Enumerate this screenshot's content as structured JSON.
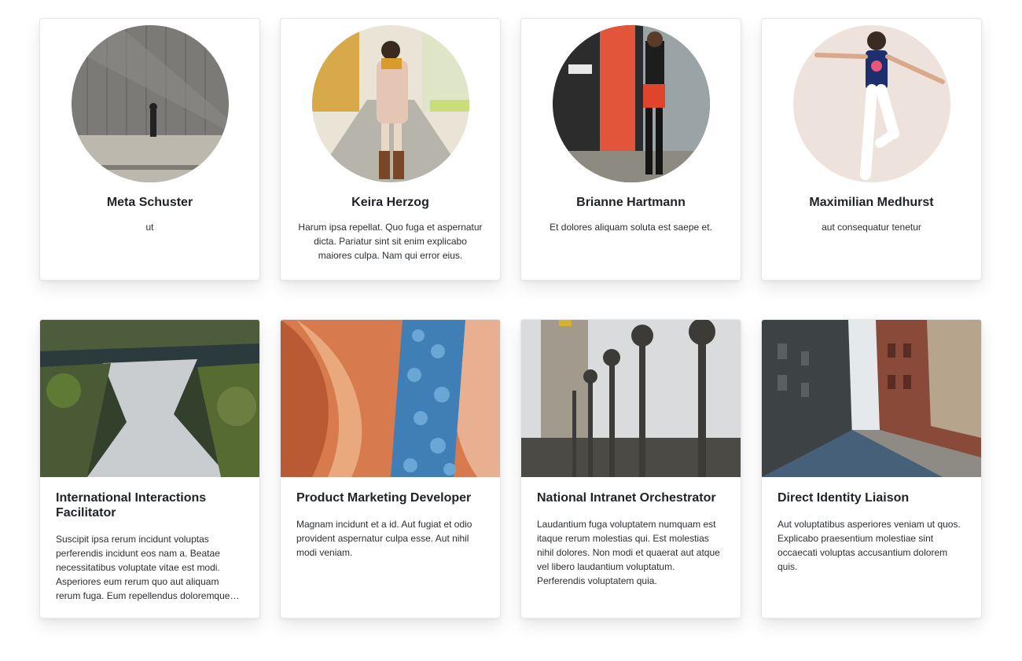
{
  "people": [
    {
      "name": "Meta Schuster",
      "text": "ut",
      "image_icon": "person-walking-by-wall-photo"
    },
    {
      "name": "Keira Herzog",
      "text": "Harum ipsa repellat. Quo fuga et aspernatur dicta. Pariatur sint sit enim explicabo maiores culpa. Nam qui error eius.",
      "image_icon": "woman-in-coat-photo"
    },
    {
      "name": "Brianne Hartmann",
      "text": "Et dolores aliquam soluta est saepe et.",
      "image_icon": "woman-with-phone-photo"
    },
    {
      "name": "Maximilian Medhurst",
      "text": "aut consequatur tenetur",
      "image_icon": "woman-jumping-photo"
    }
  ],
  "posts": [
    {
      "title": "International Interactions Facilitator",
      "text": "Suscipit ipsa rerum incidunt voluptas perferendis incidunt eos nam a. Beatae necessitatibus voluptate vitae est modi. Asperiores eum rerum quo aut aliquam rerum fuga. Eum repellendus doloremque quia.",
      "image_icon": "waterfall-photo"
    },
    {
      "title": "Product Marketing Developer",
      "text": "Magnam incidunt et a id. Aut fugiat et odio provident aspernatur culpa esse. Aut nihil modi veniam.",
      "image_icon": "canyon-stones-photo"
    },
    {
      "title": "National Intranet Orchestrator",
      "text": "Laudantium fuga voluptatem numquam est itaque rerum molestias qui. Est molestias nihil dolores. Non modi et quaerat aut atque vel libero laudantium voluptatum. Perferendis voluptatem quia.",
      "image_icon": "street-lamps-photo"
    },
    {
      "title": "Direct Identity Liaison",
      "text": "Aut voluptatibus asperiores veniam ut quos. Explicabo praesentium molestiae sint occaecati voluptas accusantium dolorem quis.",
      "image_icon": "city-street-photo"
    }
  ],
  "colors": {
    "card_border": "#e6e7ea",
    "text_dark": "#1f2328",
    "background": "#ffffff"
  }
}
